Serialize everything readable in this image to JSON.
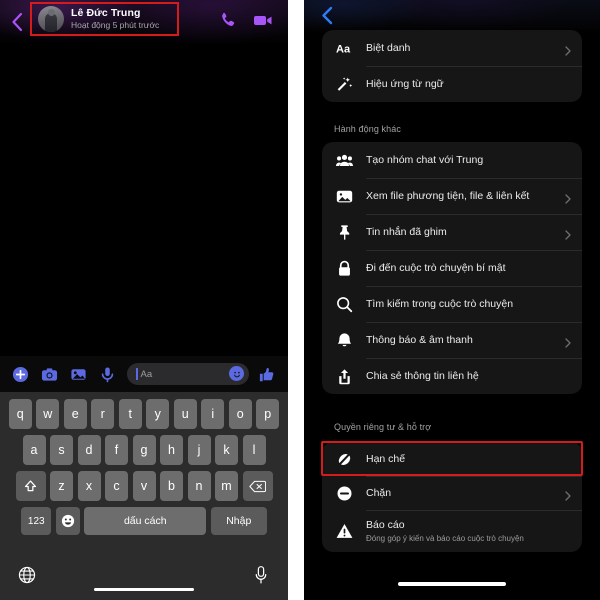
{
  "left_phone": {
    "header": {
      "back_icon": "chevron-left-icon",
      "contact_name": "Lê Đức Trung",
      "contact_status": "Hoạt động 5 phút trước",
      "avatar": "contact-avatar",
      "call_icon": "phone-icon",
      "video_icon": "video-camera-icon",
      "accent_color": "#a855f7",
      "highlight_color": "#d61b1b"
    },
    "composer": {
      "icons": [
        "plus-circle-icon",
        "camera-icon",
        "photo-icon",
        "microphone-icon"
      ],
      "placeholder": "Aa",
      "value": "",
      "emoji_icon": "smiley-icon",
      "like_icon": "thumbs-up-icon",
      "accent_color": "#5b6ae0"
    },
    "keyboard": {
      "row1": [
        "q",
        "w",
        "e",
        "r",
        "t",
        "y",
        "u",
        "i",
        "o",
        "p"
      ],
      "row2": [
        "a",
        "s",
        "d",
        "f",
        "g",
        "h",
        "j",
        "k",
        "l"
      ],
      "row3_shift": "shift-icon",
      "row3": [
        "z",
        "x",
        "c",
        "v",
        "b",
        "n",
        "m"
      ],
      "row3_backspace": "backspace-icon",
      "numeric_key": "123",
      "emoji_key": "emoji-icon",
      "space_key": "dấu cách",
      "enter_key": "Nhập",
      "globe_icon": "globe-icon",
      "dictation_icon": "microphone-icon"
    }
  },
  "right_phone": {
    "back_icon": "chevron-left-icon",
    "card_top": {
      "items": [
        {
          "icon": "aa-text-icon",
          "label": "Biệt danh",
          "chevron": true
        },
        {
          "icon": "magic-wand-icon",
          "label": "Hiệu ứng từ ngữ",
          "chevron": false
        }
      ]
    },
    "section_other": {
      "title": "Hành động khác",
      "items": [
        {
          "icon": "group-people-icon",
          "label": "Tạo nhóm chat với Trung",
          "chevron": false
        },
        {
          "icon": "media-photo-icon",
          "label": "Xem file phương tiện, file & liên kết",
          "chevron": true
        },
        {
          "icon": "pin-icon",
          "label": "Tin nhắn đã ghim",
          "chevron": true
        },
        {
          "icon": "lock-icon",
          "label": "Đi đến cuộc trò chuyện bí mật",
          "chevron": false
        },
        {
          "icon": "search-icon",
          "label": "Tìm kiếm trong cuộc trò chuyện",
          "chevron": false
        },
        {
          "icon": "bell-icon",
          "label": "Thông báo & âm thanh",
          "chevron": true
        },
        {
          "icon": "share-icon",
          "label": "Chia sẻ thông tin liên hệ",
          "chevron": false
        }
      ]
    },
    "section_privacy": {
      "title": "Quyền riêng tư & hỗ trợ",
      "items": [
        {
          "icon": "restrict-icon",
          "label": "Hạn chế",
          "sub": "",
          "chevron": false,
          "highlighted": true
        },
        {
          "icon": "block-icon",
          "label": "Chặn",
          "sub": "",
          "chevron": true,
          "highlighted": false
        },
        {
          "icon": "warning-icon",
          "label": "Báo cáo",
          "sub": "Đóng góp ý kiến và báo cáo cuộc trò chuyện",
          "chevron": false,
          "highlighted": false
        }
      ]
    },
    "highlight_color": "#d61b1b"
  }
}
